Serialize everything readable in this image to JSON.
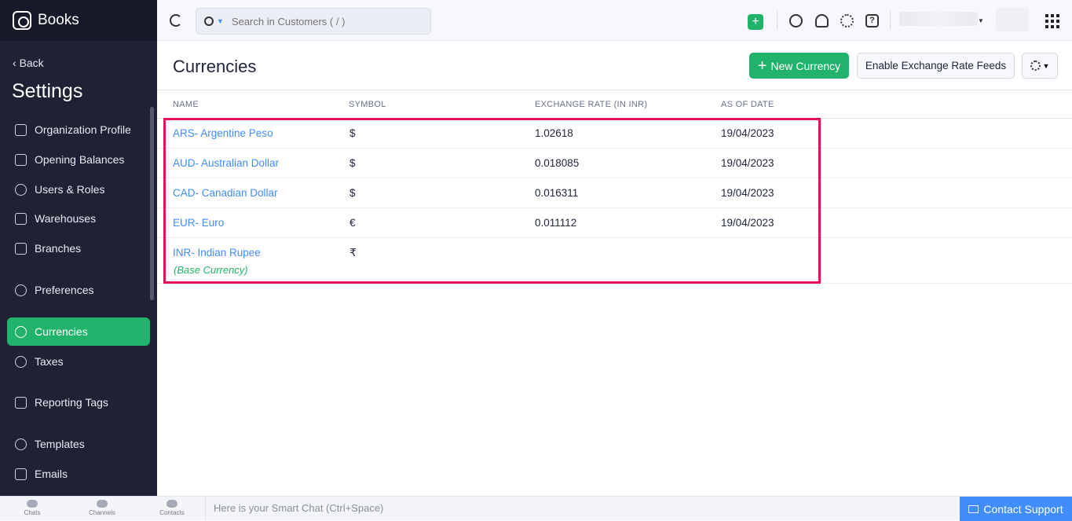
{
  "app": {
    "name": "Books"
  },
  "sidebar": {
    "back_label": "Back",
    "title": "Settings",
    "items": [
      {
        "label": "Organization Profile",
        "icon": "building-icon"
      },
      {
        "label": "Opening Balances",
        "icon": "ledger-icon"
      },
      {
        "label": "Users & Roles",
        "icon": "users-icon"
      },
      {
        "label": "Warehouses",
        "icon": "warehouse-icon"
      },
      {
        "label": "Branches",
        "icon": "branch-icon"
      },
      {
        "label": "Preferences",
        "icon": "preferences-icon"
      },
      {
        "label": "Currencies",
        "icon": "currency-icon",
        "active": true
      },
      {
        "label": "Taxes",
        "icon": "percent-icon"
      },
      {
        "label": "Reporting Tags",
        "icon": "tag-icon"
      },
      {
        "label": "Templates",
        "icon": "palette-icon"
      },
      {
        "label": "Emails",
        "icon": "mail-icon"
      }
    ]
  },
  "topbar": {
    "search_placeholder": "Search in Customers ( / )"
  },
  "page": {
    "title": "Currencies",
    "new_button": "New Currency",
    "feeds_button": "Enable Exchange Rate Feeds"
  },
  "table": {
    "columns": [
      "NAME",
      "SYMBOL",
      "EXCHANGE RATE (IN INR)",
      "AS OF DATE"
    ],
    "rows": [
      {
        "name": "ARS- Argentine Peso",
        "symbol": "$",
        "rate": "1.02618",
        "date": "19/04/2023"
      },
      {
        "name": "AUD- Australian Dollar",
        "symbol": "$",
        "rate": "0.018085",
        "date": "19/04/2023"
      },
      {
        "name": "CAD- Canadian Dollar",
        "symbol": "$",
        "rate": "0.016311",
        "date": "19/04/2023"
      },
      {
        "name": "EUR- Euro",
        "symbol": "€",
        "rate": "0.011112",
        "date": "19/04/2023"
      },
      {
        "name": "INR- Indian Rupee",
        "symbol": "₹",
        "rate": "",
        "date": "",
        "note": "(Base Currency)"
      }
    ]
  },
  "bottombar": {
    "chats": "Chats",
    "channels": "Channels",
    "contacts": "Contacts",
    "smart_chat": "Here is your Smart Chat (Ctrl+Space)",
    "support": "Contact Support"
  },
  "colors": {
    "accent": "#21b36c",
    "link": "#408dfb",
    "highlight": "#e5115b",
    "sidebar": "#1f2234"
  }
}
